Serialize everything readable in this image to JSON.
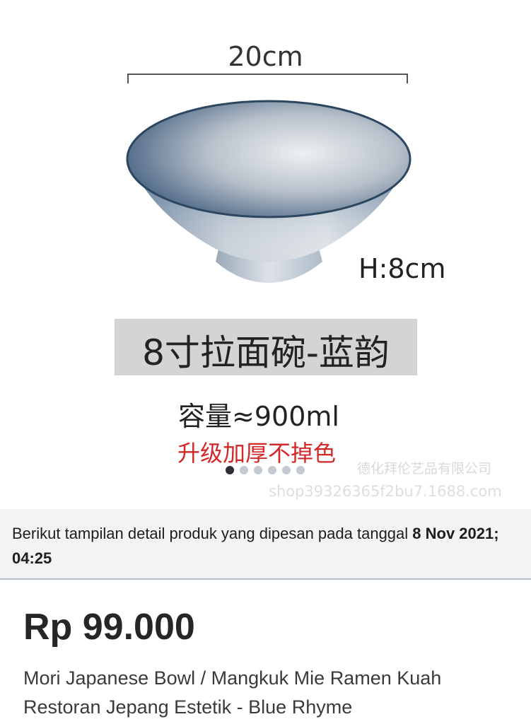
{
  "gallery": {
    "width_label": "20cm",
    "height_label": "H:8cm",
    "product_label_cn": "8寸拉面碗-蓝韵",
    "capacity": "容量≈900ml",
    "upgrade_note": "升级加厚不掉色",
    "watermark_company": "德化拜伦艺品有限公司",
    "watermark_url": "shop39326365f2bu7.1688.com",
    "image_count": 6,
    "active_index": 0
  },
  "order_info": {
    "text": "Berikut tampilan detail produk yang dipesan pada tanggal ",
    "date": "8 Nov 2021; 04:25"
  },
  "product": {
    "price": "Rp 99.000",
    "title": "Mori Japanese Bowl / Mangkuk Mie Ramen Kuah Restoran Jepang Estetik - Blue Rhyme"
  },
  "colors": {
    "bowl_dark": "#3a5570",
    "bowl_light": "#e6e8ea",
    "accent_red": "#d3282a",
    "indicator_active": "#2c2f36",
    "indicator_inactive": "#c3c9d1"
  }
}
